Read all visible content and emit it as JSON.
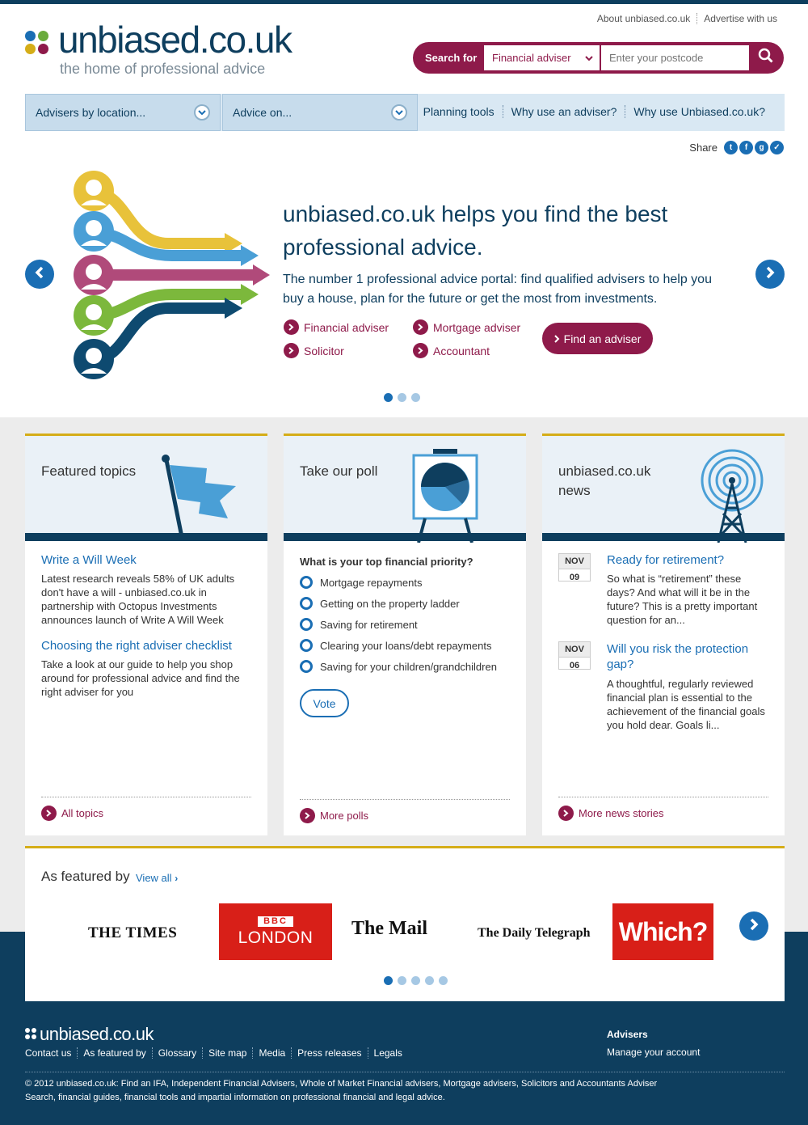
{
  "header": {
    "top_links": [
      "About unbiased.co.uk",
      "Advertise with us"
    ],
    "logo_text": "unbiased.co.uk",
    "tagline": "the home of professional advice",
    "search": {
      "label": "Search for",
      "selected": "Financial adviser",
      "placeholder": "Enter your postcode"
    }
  },
  "nav": {
    "dropdowns": [
      "Advisers by location...",
      "Advice on..."
    ],
    "links": [
      "Planning tools",
      "Why use an adviser?",
      "Why use Unbiased.co.uk?"
    ]
  },
  "share": {
    "label": "Share",
    "icons": [
      "twitter-icon",
      "facebook-icon",
      "google-plus-icon",
      "email-icon"
    ]
  },
  "hero": {
    "title": "unbiased.co.uk helps you find the best professional advice.",
    "description": "The number 1 professional advice portal: find qualified advisers to help you buy a house, plan for the future or get the most from investments.",
    "links": [
      "Financial adviser",
      "Mortgage adviser",
      "Solicitor",
      "Accountant"
    ],
    "cta": "Find an adviser",
    "slide_count": 3,
    "active_slide": 1
  },
  "panels": {
    "topics": {
      "title": "Featured topics",
      "items": [
        {
          "title": "Write a Will Week",
          "text": "Latest research reveals 58% of UK adults don't have a will - unbiased.co.uk in partnership with Octopus Investments announces launch of Write A Will Week"
        },
        {
          "title": "Choosing the right adviser checklist",
          "text": "Take a look at our guide to help you shop around for professional advice and find the right adviser for you"
        }
      ],
      "footer": "All topics"
    },
    "poll": {
      "title": "Take our poll",
      "question": "What is your top financial priority?",
      "options": [
        "Mortgage repayments",
        "Getting on the property ladder",
        "Saving for retirement",
        "Clearing your loans/debt repayments",
        "Saving for your children/grandchildren"
      ],
      "vote": "Vote",
      "footer": "More polls"
    },
    "news": {
      "title": "unbiased.co.uk news",
      "items": [
        {
          "month": "NOV",
          "day": "09",
          "title": "Ready for retirement?",
          "text": "So what is “retirement” these days?  And what will it be in the future?  This is a pretty important question for an..."
        },
        {
          "month": "NOV",
          "day": "06",
          "title": "Will you risk the protection gap?",
          "text": "A thoughtful, regularly reviewed financial plan is essential to the achievement of the financial goals you hold dear.  Goals li..."
        }
      ],
      "footer": "More news stories"
    }
  },
  "featured": {
    "title": "As featured by",
    "view_all": "View all",
    "logos": [
      "THE TIMES",
      "BBC LONDON",
      "The Mail on Sunday",
      "The Daily Telegraph",
      "Which?"
    ],
    "slide_count": 5
  },
  "footer": {
    "logo_text": "unbiased.co.uk",
    "links": [
      "Contact us",
      "As featured by",
      "Glossary",
      "Site map",
      "Media",
      "Press releases",
      "Legals"
    ],
    "advisers_heading": "Advisers",
    "advisers_link": "Manage your account",
    "copyright": "© 2012 unbiased.co.uk: Find an IFA, Independent Financial Advisers, Whole of Market Financial advisers, Mortgage advisers, Solicitors and Accountants Adviser Search, financial guides, financial tools and impartial information on professional financial and legal advice."
  },
  "colors": {
    "brand_navy": "#0e3e5e",
    "brand_plum": "#8e1a4a",
    "accent_blue": "#1a6eb4",
    "gold": "#d5ad18"
  }
}
